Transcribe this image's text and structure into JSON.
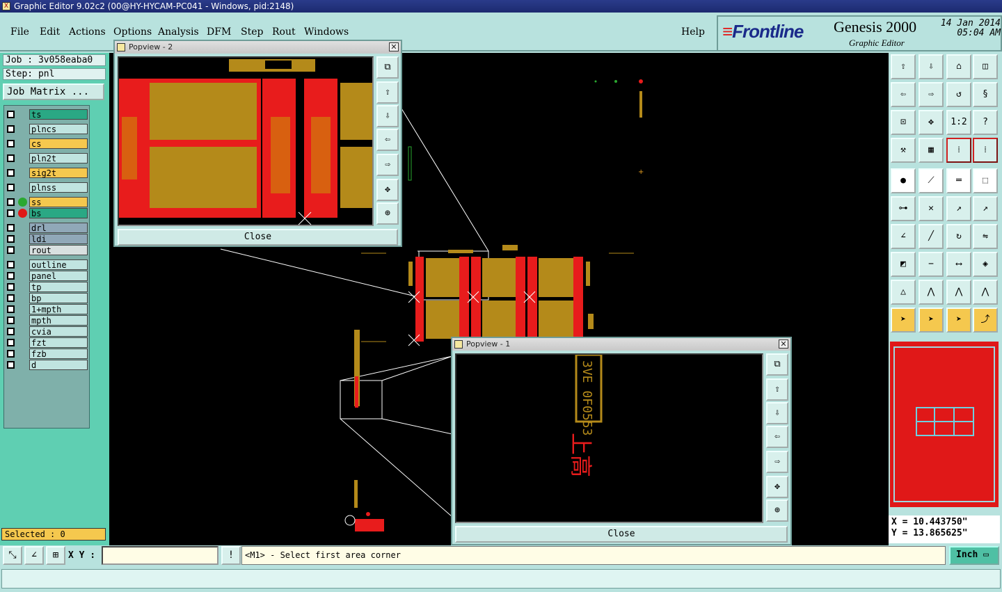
{
  "window": {
    "title": "Graphic Editor 9.02c2 (00@HY-HYCAM-PC041 - Windows, pid:2148)"
  },
  "menu": [
    "File",
    "Edit",
    "Actions",
    "Options",
    "Analysis",
    "DFM",
    "Step",
    "Rout",
    "Windows"
  ],
  "help": "Help",
  "brand": {
    "logo": "Frontline",
    "product": "Genesis 2000",
    "subtitle": "Graphic Editor",
    "date": "14 Jan 2014",
    "time": "05:04 AM"
  },
  "job": {
    "name": "Job : 3v058eaba0",
    "step": "Step: pnl",
    "matrix_button": "Job Matrix ..."
  },
  "layers": [
    {
      "name": "ts",
      "color": "#2aa884"
    },
    {
      "name": "plncs",
      "color": "#c0e4e0"
    },
    {
      "name": "cs",
      "color": "#f5c84e"
    },
    {
      "name": "pln2t",
      "color": "#c0e4e0"
    },
    {
      "name": "sig2t",
      "color": "#f5c84e"
    },
    {
      "name": "plnss",
      "color": "#c0e4e0"
    },
    {
      "name": "ss",
      "color": "#f5c84e",
      "dot": "#2aa830"
    },
    {
      "name": "bs",
      "color": "#2aa884",
      "dot": "#e01818"
    },
    {
      "name": "drl",
      "color": "#90a8b8"
    },
    {
      "name": "ldi",
      "color": "#90a8b8"
    },
    {
      "name": "rout",
      "color": "#d8e0e0"
    },
    {
      "name": "outline",
      "color": "#c0e4e0"
    },
    {
      "name": "panel",
      "color": "#c0e4e0"
    },
    {
      "name": "tp",
      "color": "#c0e4e0"
    },
    {
      "name": "bp",
      "color": "#c0e4e0"
    },
    {
      "name": "1+mpth",
      "color": "#c0e4e0"
    },
    {
      "name": "mpth",
      "color": "#c0e4e0"
    },
    {
      "name": "cvia",
      "color": "#c0e4e0"
    },
    {
      "name": "fzt",
      "color": "#c0e4e0"
    },
    {
      "name": "fzb",
      "color": "#c0e4e0"
    },
    {
      "name": "d",
      "color": "#c0e4e0"
    }
  ],
  "selected": "Selected : 0",
  "popview2": {
    "title": "Popview - 2",
    "close": "Close"
  },
  "popview1": {
    "title": "Popview - 1",
    "close": "Close",
    "text_sample": "3VE 0F0553"
  },
  "coords": {
    "x": "X = 10.443750\"",
    "y": "Y = 13.865625\""
  },
  "bottom": {
    "xy_label": "X Y :",
    "xy_value": "",
    "prompt": "<M1> - Select first area corner",
    "units": "Inch"
  },
  "colors": {
    "board_red": "#e81c1c",
    "board_olive": "#b48a1a",
    "panel_bg": "#b8e2de",
    "highlight": "#f5c84e"
  }
}
